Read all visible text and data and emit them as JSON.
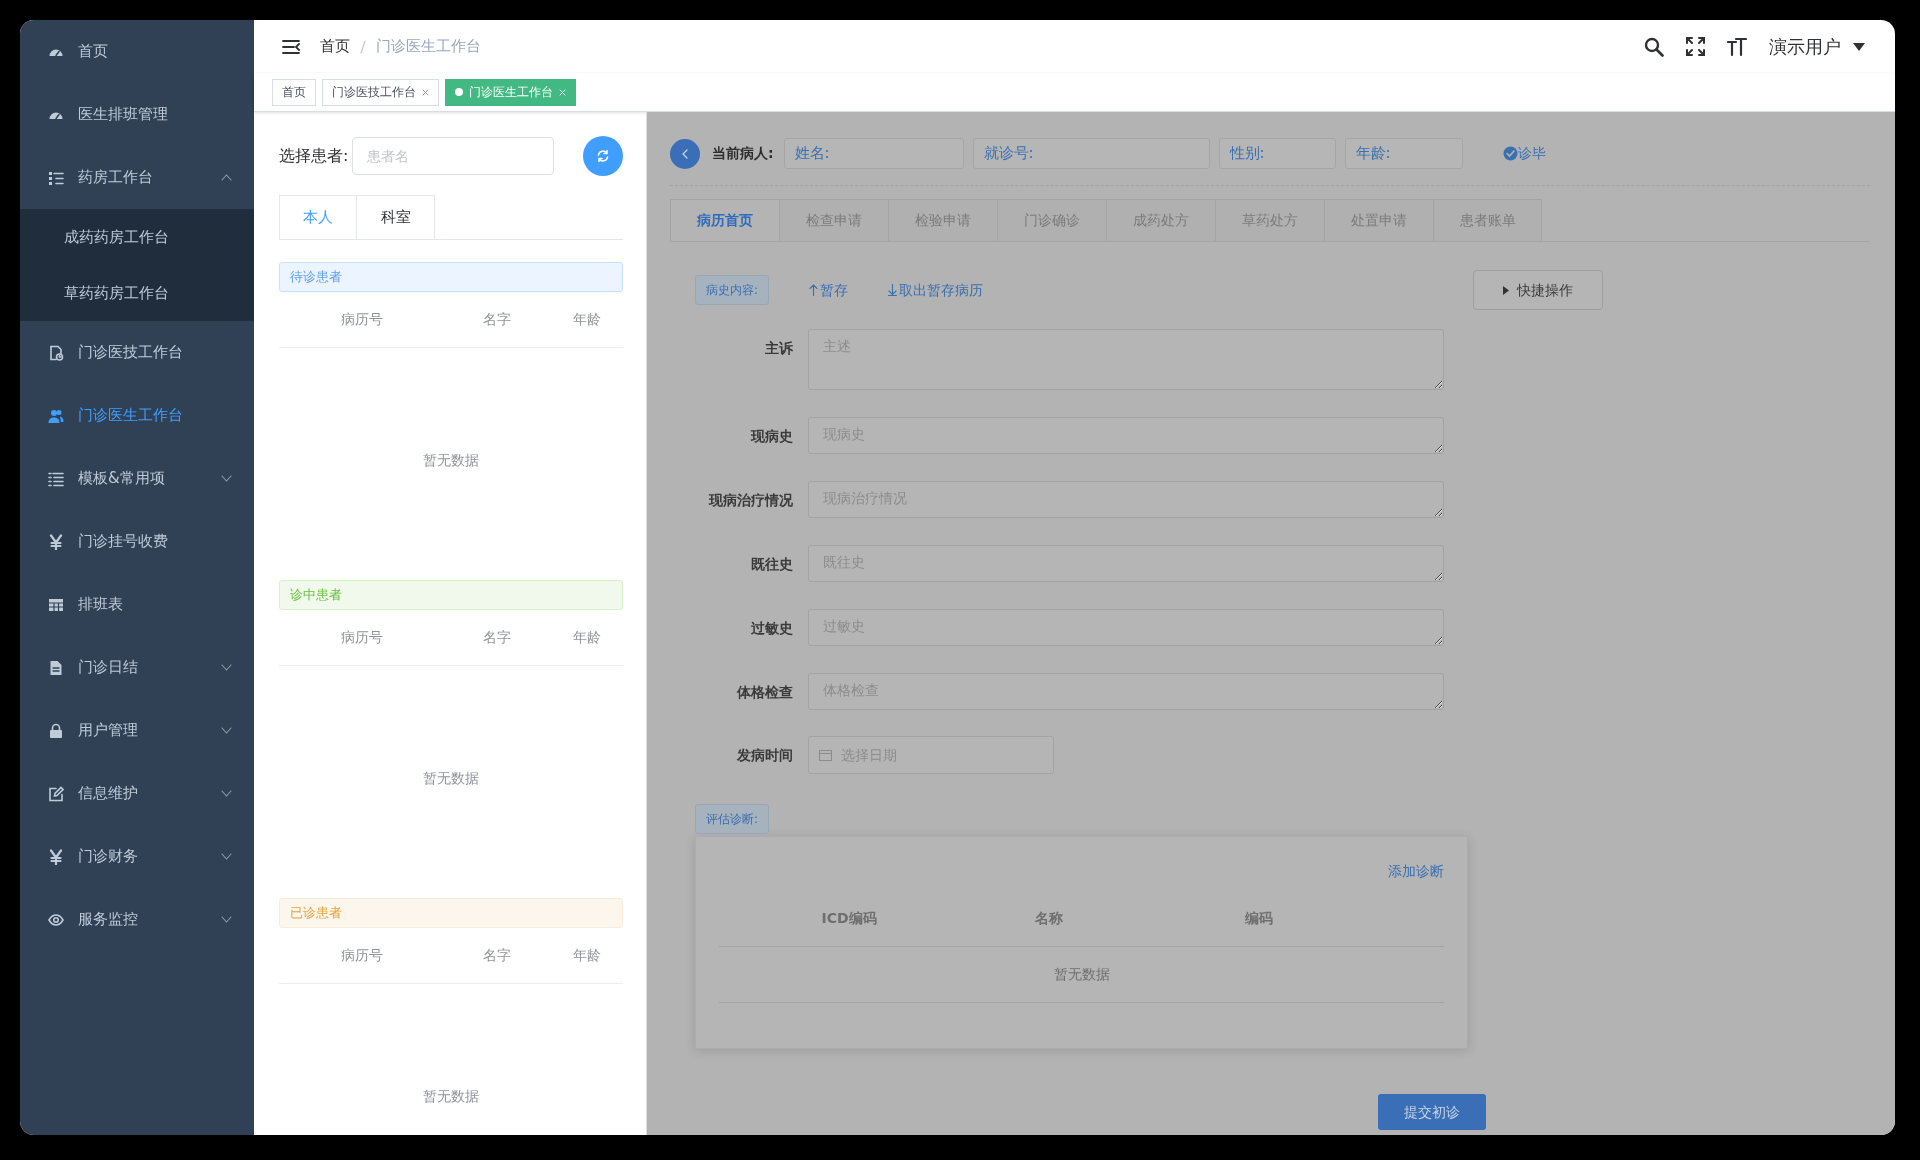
{
  "sidebar": {
    "items": [
      {
        "label": "首页",
        "selected": false
      },
      {
        "label": "医生排班管理",
        "selected": false
      },
      {
        "label": "药房工作台",
        "selected": false,
        "expanded": true,
        "children": [
          {
            "label": "成药药房工作台",
            "selected": false
          },
          {
            "label": "草药药房工作台",
            "selected": false
          }
        ]
      },
      {
        "label": "门诊医技工作台",
        "selected": false
      },
      {
        "label": "门诊医生工作台",
        "selected": true
      },
      {
        "label": "模板&常用项",
        "selected": false,
        "expanded": false
      },
      {
        "label": "门诊挂号收费",
        "selected": false
      },
      {
        "label": "排班表",
        "selected": false
      },
      {
        "label": "门诊日结",
        "selected": false,
        "expanded": false
      },
      {
        "label": "用户管理",
        "selected": false,
        "expanded": false
      },
      {
        "label": "信息维护",
        "selected": false,
        "expanded": false
      },
      {
        "label": "门诊财务",
        "selected": false,
        "expanded": false
      },
      {
        "label": "服务监控",
        "selected": false,
        "expanded": false
      }
    ]
  },
  "header": {
    "breadcrumb": [
      {
        "label": "首页"
      },
      {
        "label": "门诊医生工作台"
      }
    ],
    "user": "演示用户"
  },
  "tags": [
    {
      "label": "首页",
      "selected": false,
      "closable": false
    },
    {
      "label": "门诊医技工作台",
      "selected": false,
      "closable": true
    },
    {
      "label": "门诊医生工作台",
      "selected": true,
      "closable": true
    }
  ],
  "patient_picker": {
    "label": "选择患者:",
    "placeholder": "患者名",
    "tabs": [
      {
        "label": "本人",
        "selected": true
      },
      {
        "label": "科室",
        "selected": false
      }
    ],
    "sections": [
      {
        "title": "待诊患者",
        "kind": "waiting",
        "columns": [
          "病历号",
          "名字",
          "年龄"
        ],
        "empty_text": "暂无数据"
      },
      {
        "title": "诊中患者",
        "kind": "in_progress",
        "columns": [
          "病历号",
          "名字",
          "年龄"
        ],
        "empty_text": "暂无数据"
      },
      {
        "title": "已诊患者",
        "kind": "done",
        "columns": [
          "病历号",
          "名字",
          "年龄"
        ],
        "empty_text": "暂无数据"
      }
    ]
  },
  "workbench": {
    "patient_label": "当前病人:",
    "patient_fields": [
      "姓名:",
      "就诊号:",
      "性别:",
      "年龄:"
    ],
    "finish": "诊毕",
    "tabs": [
      {
        "label": "病历首页",
        "selected": true
      },
      {
        "label": "检查申请",
        "selected": false
      },
      {
        "label": "检验申请",
        "selected": false
      },
      {
        "label": "门诊确诊",
        "selected": false
      },
      {
        "label": "成药处方",
        "selected": false
      },
      {
        "label": "草药处方",
        "selected": false
      },
      {
        "label": "处置申请",
        "selected": false
      },
      {
        "label": "患者账单",
        "selected": false
      }
    ],
    "history_tag": "病史内容:",
    "save": "暂存",
    "load": "取出暂存病历",
    "quick": "快捷操作",
    "form": [
      {
        "label": "主诉",
        "placeholder": "主述",
        "kind": "textarea"
      },
      {
        "label": "现病史",
        "placeholder": "现病史",
        "kind": "textline"
      },
      {
        "label": "现病治疗情况",
        "placeholder": "现病治疗情况",
        "kind": "textline"
      },
      {
        "label": "既往史",
        "placeholder": "既往史",
        "kind": "textline"
      },
      {
        "label": "过敏史",
        "placeholder": "过敏史",
        "kind": "textline"
      },
      {
        "label": "体格检查",
        "placeholder": "体格检查",
        "kind": "textline"
      },
      {
        "label": "发病时间",
        "placeholder": "选择日期",
        "kind": "date"
      }
    ],
    "diagnosis": {
      "tag": "评估诊断:",
      "add": "添加诊断",
      "columns": [
        "ICD编码",
        "名称",
        "编码"
      ],
      "empty_text": "暂无数据"
    },
    "submit": "提交初诊"
  }
}
